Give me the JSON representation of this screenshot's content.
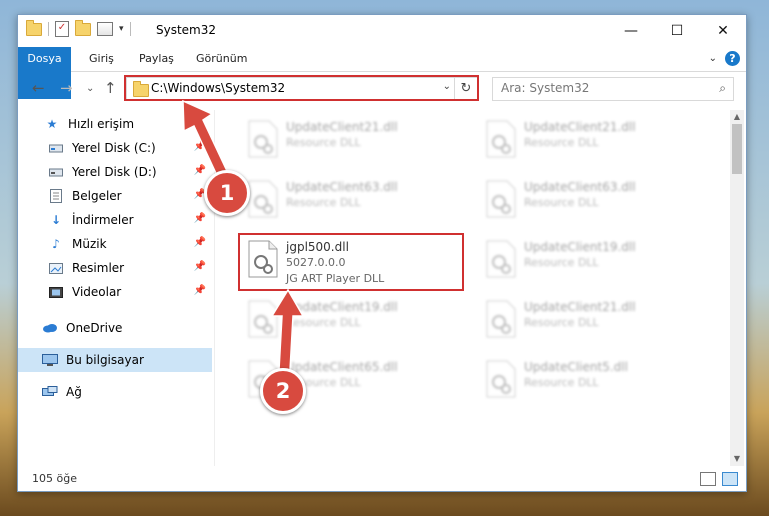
{
  "window": {
    "title": "System32",
    "controls": {
      "minimize": "—",
      "maximize": "☐",
      "close": "✕"
    }
  },
  "ribbon": {
    "tabs": [
      "Dosya",
      "Giriş",
      "Paylaş",
      "Görünüm"
    ],
    "help": "?",
    "collapse_chevron": "⌄"
  },
  "navigation": {
    "back": "←",
    "forward": "→",
    "recent": "⌄",
    "up": "↑"
  },
  "address": {
    "path": "C:\\Windows\\System32",
    "dropdown": "⌄",
    "refresh": "↻"
  },
  "search": {
    "placeholder": "Ara: System32",
    "icon": "search-icon"
  },
  "sidebar": {
    "quick_access": "Hızlı erişim",
    "items": [
      {
        "label": "Yerel Disk (C:)",
        "icon": "drive-icon",
        "pinned": true
      },
      {
        "label": "Yerel Disk (D:)",
        "icon": "drive-icon",
        "pinned": true
      },
      {
        "label": "Belgeler",
        "icon": "documents-icon",
        "pinned": true
      },
      {
        "label": "İndirmeler",
        "icon": "download-icon",
        "pinned": true
      },
      {
        "label": "Müzik",
        "icon": "music-icon",
        "pinned": true
      },
      {
        "label": "Resimler",
        "icon": "pictures-icon",
        "pinned": true
      },
      {
        "label": "Videolar",
        "icon": "videos-icon",
        "pinned": true
      }
    ],
    "onedrive": "OneDrive",
    "this_pc": "Bu bilgisayar",
    "network": "Ağ"
  },
  "files": [
    {
      "name": "UpdateClient21.dll",
      "line1": "Resource DLL",
      "line2": "",
      "blurred": true
    },
    {
      "name": "UpdateClient21.dll",
      "line1": "Resource DLL",
      "line2": "",
      "blurred": true
    },
    {
      "name": "UpdateClient63.dll",
      "line1": "Resource DLL",
      "line2": "",
      "blurred": true
    },
    {
      "name": "UpdateClient63.dll",
      "line1": "Resource DLL",
      "line2": "",
      "blurred": true
    },
    {
      "name": "jgpl500.dll",
      "line1": "5027.0.0.0",
      "line2": "JG ART Player DLL",
      "blurred": false
    },
    {
      "name": "UpdateClient19.dll",
      "line1": "Resource DLL",
      "line2": "",
      "blurred": true
    },
    {
      "name": "UpdateClient19.dll",
      "line1": "Resource DLL",
      "line2": "",
      "blurred": true
    },
    {
      "name": "UpdateClient21.dll",
      "line1": "Resource DLL",
      "line2": "",
      "blurred": true
    },
    {
      "name": "UpdateClient65.dll",
      "line1": "Resource DLL",
      "line2": "",
      "blurred": true
    },
    {
      "name": "UpdateClient5.dll",
      "line1": "Resource DLL",
      "line2": "",
      "blurred": true
    }
  ],
  "status": {
    "item_count": "105 öğe"
  },
  "annotations": {
    "step1": "1",
    "step2": "2",
    "color": "#d84a3f"
  }
}
